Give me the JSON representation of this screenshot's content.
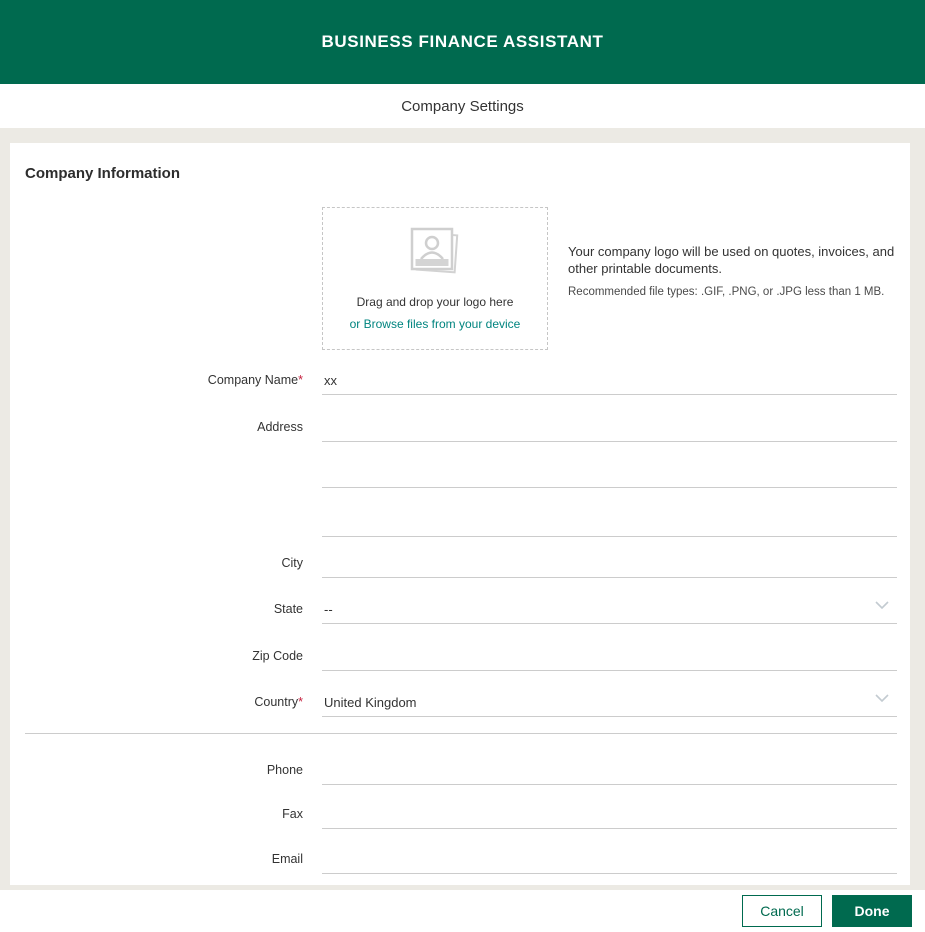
{
  "header": {
    "title": "BUSINESS FINANCE ASSISTANT"
  },
  "subheader": {
    "title": "Company Settings"
  },
  "section": {
    "title": "Company Information"
  },
  "logo_upload": {
    "icon": "photo-placeholder-icon",
    "drag_text": "Drag and drop your logo here",
    "browse_text": "or Browse files from your device",
    "description": "Your company logo will be used on quotes, invoices, and other printable documents.",
    "recommendation": "Recommended file types: .GIF, .PNG, or .JPG less than 1 MB."
  },
  "form": {
    "fields": [
      {
        "id": "company-name",
        "label": "Company Name",
        "required_mark": "*",
        "value": "xx",
        "type": "text"
      },
      {
        "id": "address-line-1",
        "label": "Address",
        "value": "",
        "type": "text"
      },
      {
        "id": "address-line-2",
        "label": "",
        "value": "",
        "type": "text"
      },
      {
        "id": "address-line-3",
        "label": "",
        "value": "",
        "type": "text"
      },
      {
        "id": "city",
        "label": "City",
        "value": "",
        "type": "text"
      },
      {
        "id": "state",
        "label": "State",
        "value": "--",
        "type": "select"
      },
      {
        "id": "zip-code",
        "label": "Zip Code",
        "value": "",
        "type": "text"
      },
      {
        "id": "country",
        "label": "Country",
        "required_mark": "*",
        "value": "United Kingdom",
        "type": "select"
      },
      {
        "id": "phone",
        "label": "Phone",
        "value": "",
        "type": "text"
      },
      {
        "id": "fax",
        "label": "Fax",
        "value": "",
        "type": "text"
      },
      {
        "id": "email",
        "label": "Email",
        "value": "",
        "type": "text"
      }
    ]
  },
  "footer": {
    "cancel_label": "Cancel",
    "done_label": "Done"
  },
  "colors": {
    "brand_green": "#006a4f",
    "link_teal": "#00847f",
    "required_red": "#c5203e",
    "page_background": "#eceae4",
    "line_gray": "#cccccc"
  }
}
